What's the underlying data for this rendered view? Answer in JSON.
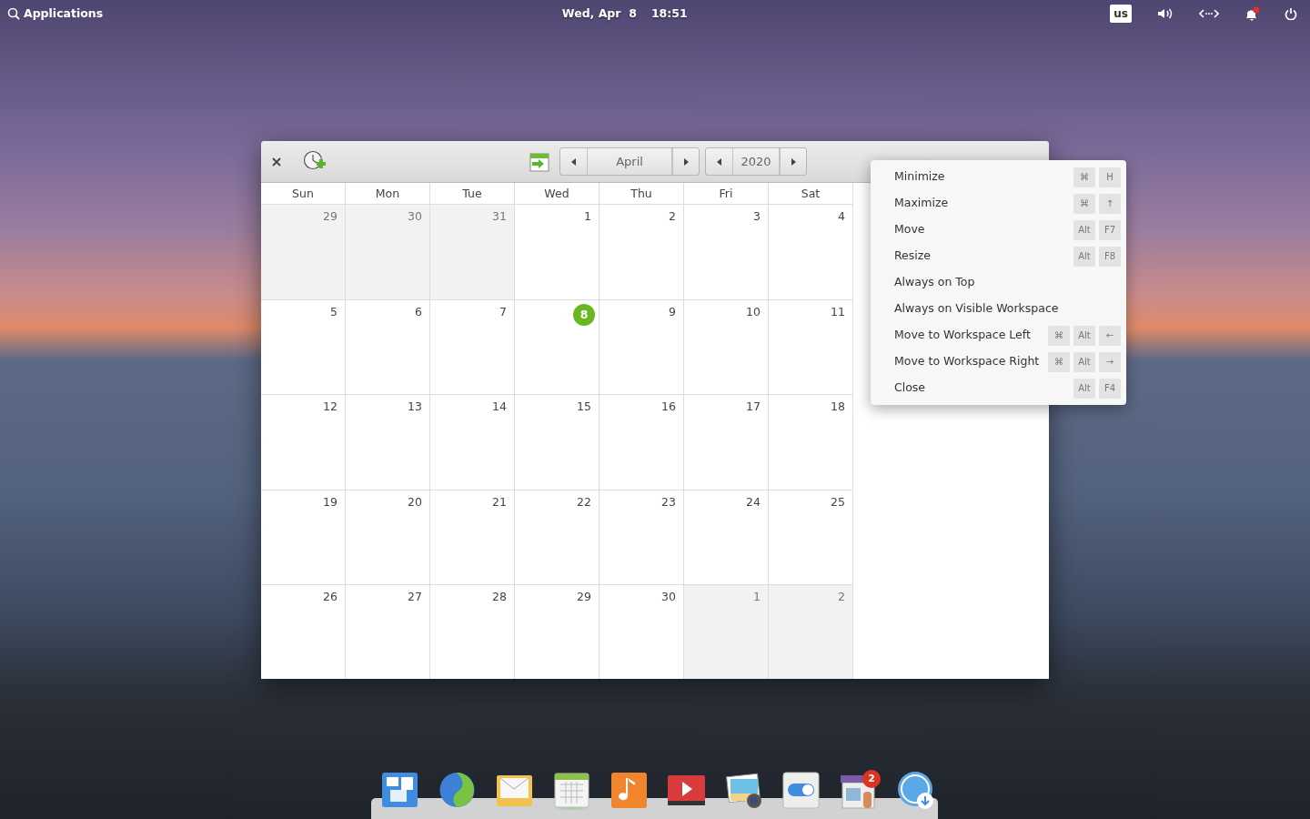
{
  "panel": {
    "applications": "Applications",
    "date": "Wed, Apr  8",
    "time": "18:51",
    "keyboard": "us"
  },
  "window": {
    "month": "April",
    "year": "2020",
    "weekdays": [
      "Sun",
      "Mon",
      "Tue",
      "Wed",
      "Thu",
      "Fri",
      "Sat"
    ],
    "weeks": [
      [
        {
          "day": "29",
          "outside": true,
          "today": false
        },
        {
          "day": "30",
          "outside": true,
          "today": false
        },
        {
          "day": "31",
          "outside": true,
          "today": false
        },
        {
          "day": "1",
          "outside": false,
          "today": false
        },
        {
          "day": "2",
          "outside": false,
          "today": false
        },
        {
          "day": "3",
          "outside": false,
          "today": false
        },
        {
          "day": "4",
          "outside": false,
          "today": false
        }
      ],
      [
        {
          "day": "5",
          "outside": false,
          "today": false
        },
        {
          "day": "6",
          "outside": false,
          "today": false
        },
        {
          "day": "7",
          "outside": false,
          "today": false
        },
        {
          "day": "8",
          "outside": false,
          "today": true
        },
        {
          "day": "9",
          "outside": false,
          "today": false
        },
        {
          "day": "10",
          "outside": false,
          "today": false
        },
        {
          "day": "11",
          "outside": false,
          "today": false
        }
      ],
      [
        {
          "day": "12",
          "outside": false,
          "today": false
        },
        {
          "day": "13",
          "outside": false,
          "today": false
        },
        {
          "day": "14",
          "outside": false,
          "today": false
        },
        {
          "day": "15",
          "outside": false,
          "today": false
        },
        {
          "day": "16",
          "outside": false,
          "today": false
        },
        {
          "day": "17",
          "outside": false,
          "today": false
        },
        {
          "day": "18",
          "outside": false,
          "today": false
        }
      ],
      [
        {
          "day": "19",
          "outside": false,
          "today": false
        },
        {
          "day": "20",
          "outside": false,
          "today": false
        },
        {
          "day": "21",
          "outside": false,
          "today": false
        },
        {
          "day": "22",
          "outside": false,
          "today": false
        },
        {
          "day": "23",
          "outside": false,
          "today": false
        },
        {
          "day": "24",
          "outside": false,
          "today": false
        },
        {
          "day": "25",
          "outside": false,
          "today": false
        }
      ],
      [
        {
          "day": "26",
          "outside": false,
          "today": false
        },
        {
          "day": "27",
          "outside": false,
          "today": false
        },
        {
          "day": "28",
          "outside": false,
          "today": false
        },
        {
          "day": "29",
          "outside": false,
          "today": false
        },
        {
          "day": "30",
          "outside": false,
          "today": false
        },
        {
          "day": "1",
          "outside": true,
          "today": false
        },
        {
          "day": "2",
          "outside": true,
          "today": false
        }
      ]
    ]
  },
  "context_menu": [
    {
      "label": "Minimize",
      "keys": [
        "⌘",
        "H"
      ]
    },
    {
      "label": "Maximize",
      "keys": [
        "⌘",
        "↑"
      ]
    },
    {
      "label": "Move",
      "keys": [
        "Alt",
        "F7"
      ]
    },
    {
      "label": "Resize",
      "keys": [
        "Alt",
        "F8"
      ]
    },
    {
      "label": "Always on Top"
    },
    {
      "label": "Always on Visible Workspace"
    },
    {
      "label": "Move to Workspace Left",
      "keys": [
        "⌘",
        "Alt",
        "←"
      ]
    },
    {
      "label": "Move to Workspace Right",
      "keys": [
        "⌘",
        "Alt",
        "→"
      ]
    },
    {
      "label": "Close",
      "keys": [
        "Alt",
        "F4"
      ]
    }
  ],
  "dock": [
    {
      "kind": "tiles",
      "running": false
    },
    {
      "kind": "globe",
      "running": false
    },
    {
      "kind": "mail",
      "running": false
    },
    {
      "kind": "calendar",
      "running": true
    },
    {
      "kind": "music",
      "running": false
    },
    {
      "kind": "video",
      "running": false
    },
    {
      "kind": "photos",
      "running": false
    },
    {
      "kind": "switch",
      "running": false
    },
    {
      "kind": "store",
      "running": false,
      "badge": "2"
    },
    {
      "kind": "download",
      "running": false
    }
  ]
}
